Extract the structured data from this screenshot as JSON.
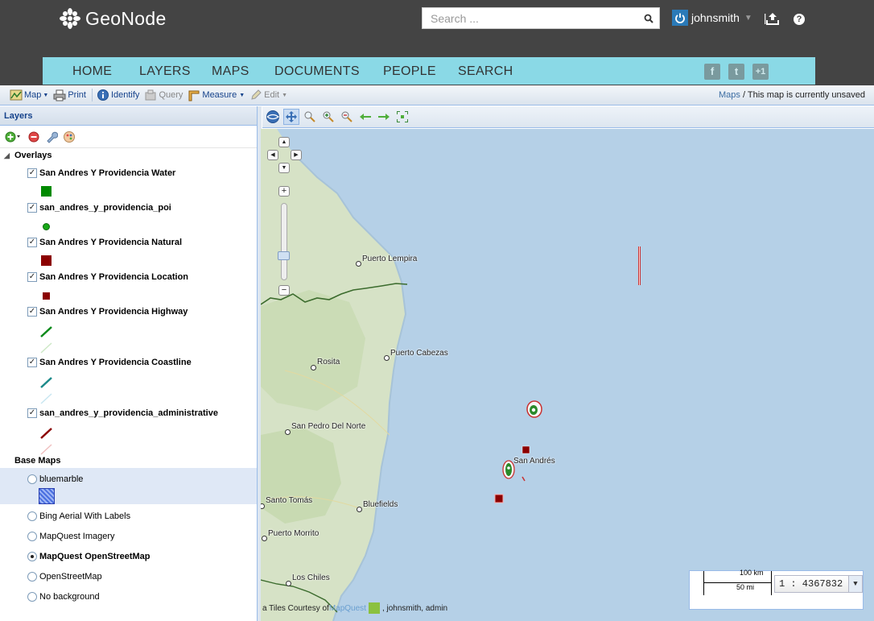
{
  "brand": {
    "name": "GeoNode"
  },
  "search": {
    "placeholder": "Search ..."
  },
  "user": {
    "name": "johnsmith",
    "separator": "|"
  },
  "nav": {
    "items": [
      "HOME",
      "LAYERS",
      "MAPS",
      "DOCUMENTS",
      "PEOPLE",
      "SEARCH"
    ]
  },
  "social": {
    "facebook": "f",
    "twitter": "t",
    "plusone": "+1"
  },
  "toolbar": {
    "map_label": "Map",
    "print_label": "Print",
    "identify_label": "Identify",
    "query_label": "Query",
    "measure_label": "Measure",
    "edit_label": "Edit",
    "breadcrumb_link": "Maps",
    "breadcrumb_text": " / This map is currently unsaved"
  },
  "layers_panel": {
    "title": "Layers",
    "overlays_label": "Overlays",
    "base_maps_label": "Base Maps",
    "overlays": [
      {
        "name": "San Andres Y Providencia Water",
        "checked": true,
        "legend": "square",
        "color": "#008a00"
      },
      {
        "name": "san_andres_y_providencia_poi",
        "checked": true,
        "legend": "dot",
        "color": "#18a818"
      },
      {
        "name": "San Andres Y Providencia Natural",
        "checked": true,
        "legend": "square",
        "color": "#8b0000"
      },
      {
        "name": "San Andres Y Providencia Location",
        "checked": true,
        "legend": "small-square",
        "color": "#8b0000"
      },
      {
        "name": "San Andres Y Providencia Highway",
        "checked": true,
        "legend": "lines",
        "color": "#0a8a1a",
        "color2": "#cde8c6"
      },
      {
        "name": "San Andres Y Providencia Coastline",
        "checked": true,
        "legend": "lines",
        "color": "#1c8a8a",
        "color2": "#c8e6f1"
      },
      {
        "name": "san_andres_y_providencia_administrative",
        "checked": true,
        "legend": "lines",
        "color": "#8b0000",
        "color2": "#f0c0c0"
      }
    ],
    "base_maps": [
      {
        "name": "bluemarble",
        "selected": false,
        "highlighted": true
      },
      {
        "name": "Bing Aerial With Labels",
        "selected": false
      },
      {
        "name": "MapQuest Imagery",
        "selected": false
      },
      {
        "name": "MapQuest OpenStreetMap",
        "selected": true
      },
      {
        "name": "OpenStreetMap",
        "selected": false
      },
      {
        "name": "No background",
        "selected": false
      }
    ]
  },
  "map": {
    "cities": [
      "Puerto Lempira",
      "Puerto Cabezas",
      "Rosita",
      "San Pedro Del Norte",
      "San Andrés",
      "Santo Tomás",
      "Bluefields",
      "Puerto Morrito",
      "Los Chiles"
    ],
    "colors": {
      "ocean": "#b5d0e7",
      "land": "#d7e3c7",
      "border": "#3b6b2d"
    }
  },
  "scale": {
    "km": "100 km",
    "mi": "50 mi",
    "ratio": "1 : 4367832"
  },
  "attribution": {
    "prefix": "a Tiles Courtesy of ",
    "link": "MapQuest",
    "suffix": ", johnsmith, admin"
  }
}
